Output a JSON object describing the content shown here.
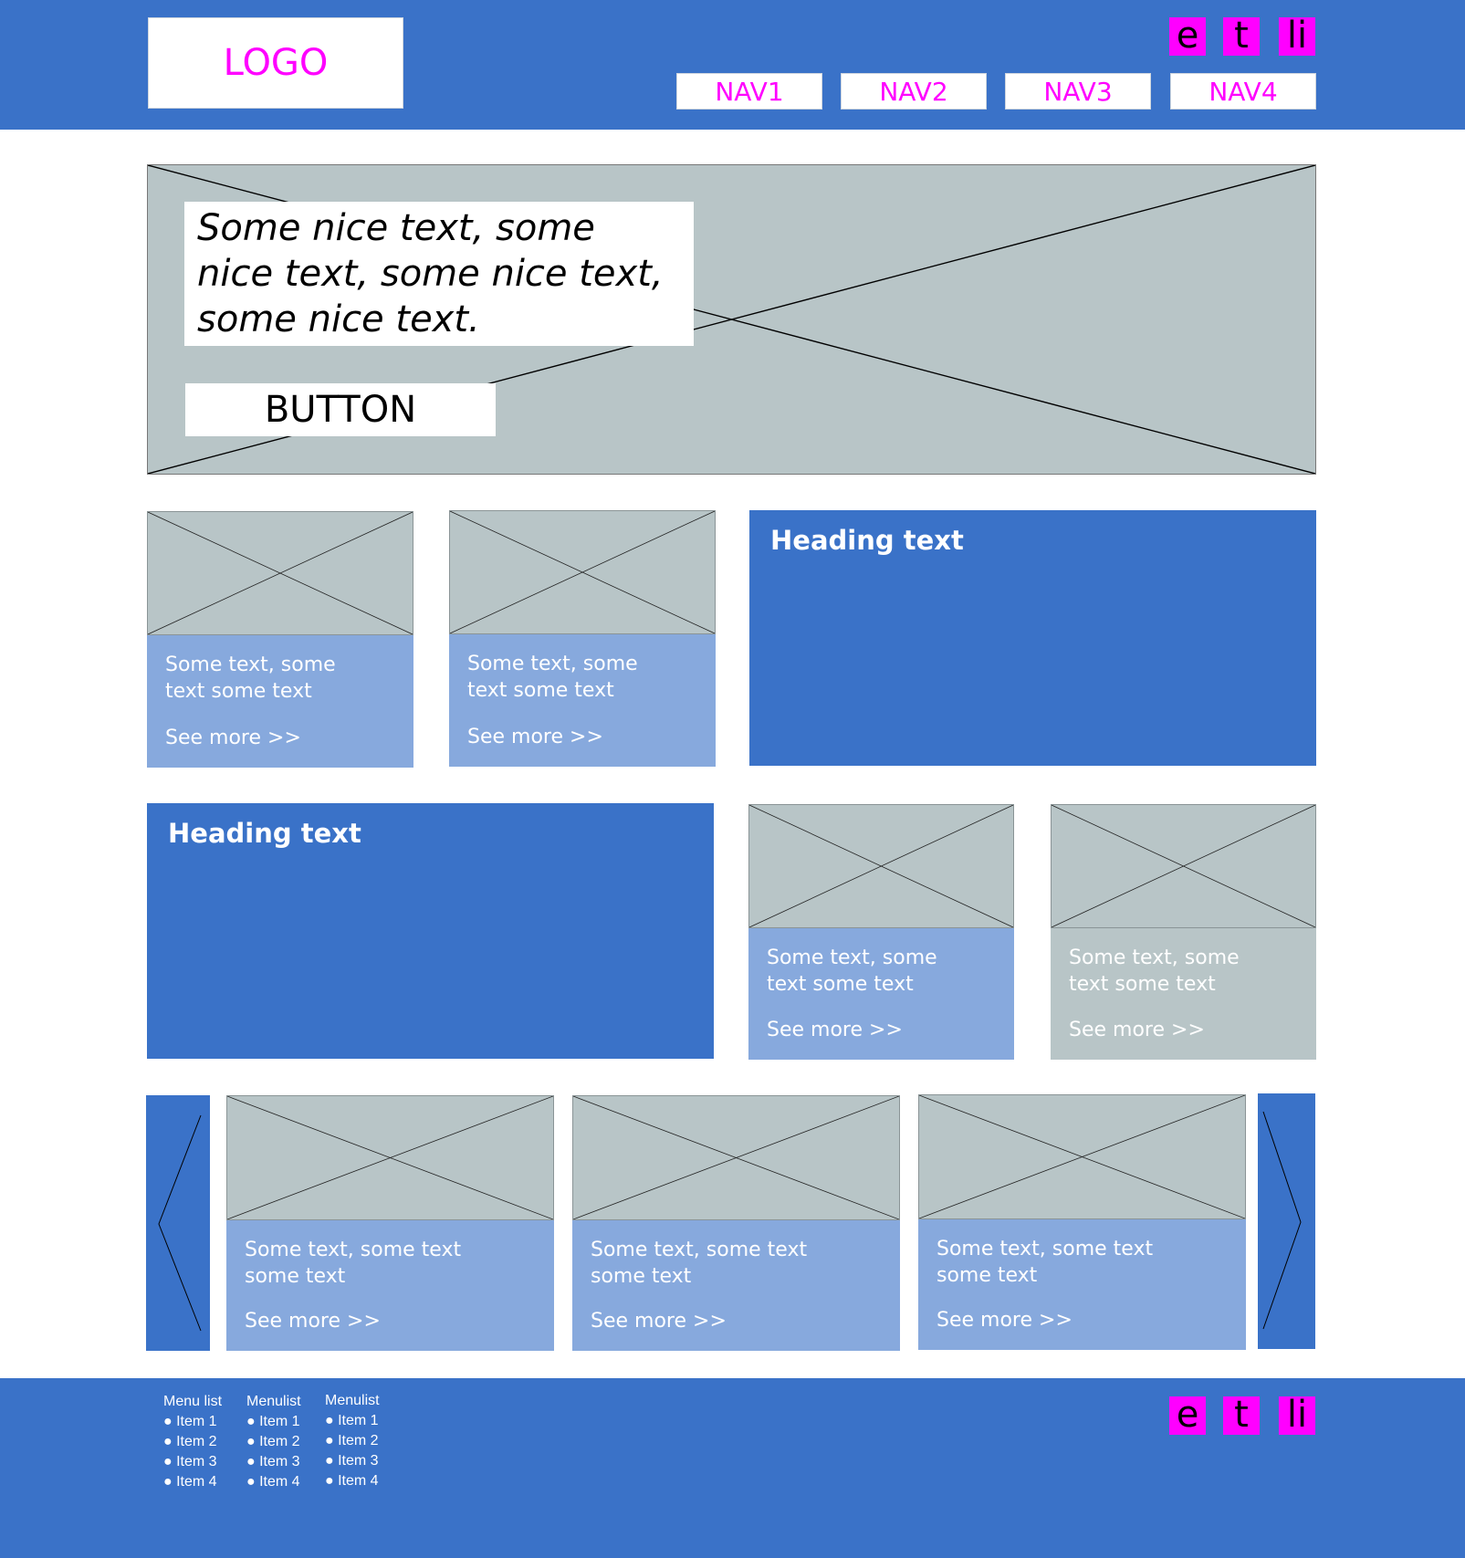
{
  "header": {
    "logo": "LOGO",
    "social": [
      "e",
      "t",
      "li"
    ],
    "nav": [
      "NAV1",
      "NAV2",
      "NAV3",
      "NAV4"
    ]
  },
  "hero": {
    "text": "Some nice text, some nice text, some nice text, some nice text.",
    "button": "BUTTON"
  },
  "card": {
    "text": "Some text, some text some text",
    "more": "See more >>"
  },
  "tiles": {
    "heading": "Heading text"
  },
  "footer": {
    "social": [
      "e",
      "t",
      "li"
    ],
    "menus": [
      {
        "title": "Menu list",
        "items": [
          "Item 1",
          "Item 2",
          "Item 3",
          "Item 4"
        ]
      },
      {
        "title": "Menulist",
        "items": [
          "Item 1",
          "Item 2",
          "Item 3",
          "Item 4"
        ]
      },
      {
        "title": "Menulist",
        "items": [
          "Item 1",
          "Item 2",
          "Item 3",
          "Item 4"
        ]
      }
    ]
  },
  "colors": {
    "primary": "#3a72c8",
    "light": "#87a9dd",
    "placeholder": "#b8c5c7",
    "accent": "#ff00ff"
  }
}
